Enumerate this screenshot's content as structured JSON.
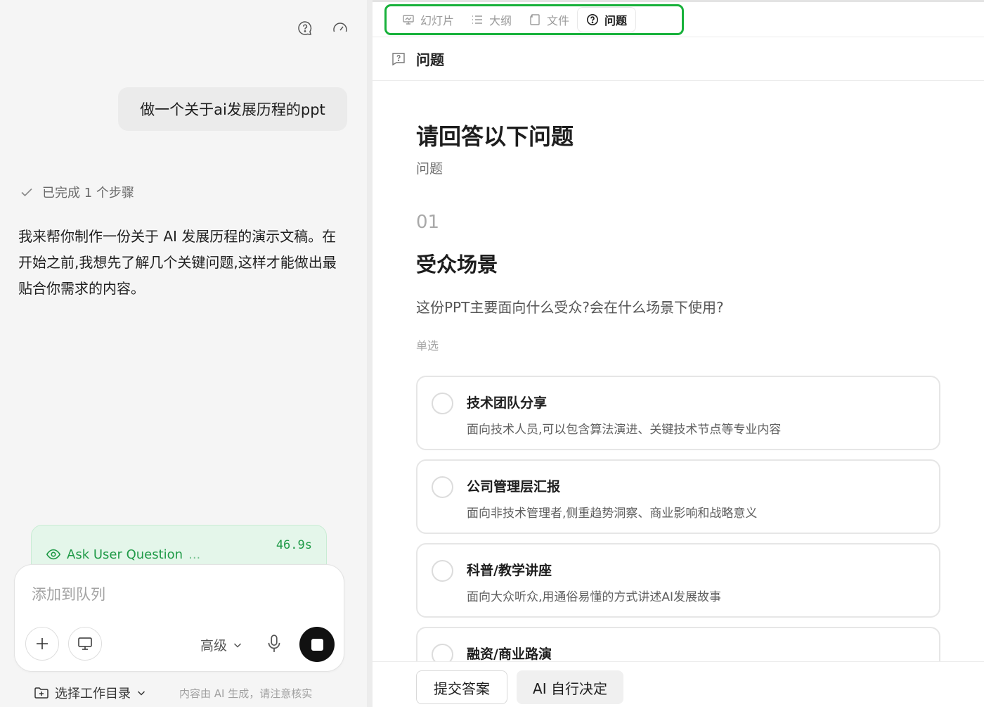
{
  "chat": {
    "user_message": "做一个关于ai发展历程的ppt",
    "steps_done": "已完成 1 个步骤",
    "assistant_message": "我来帮你制作一份关于 AI 发展历程的演示文稿。在开始之前,我想先了解几个关键问题,这样才能做出最贴合你需求的内容。",
    "tool": {
      "name": "Ask User Question",
      "dots": "...",
      "elapsed": "46.9s"
    },
    "composer": {
      "placeholder": "添加到队列",
      "advanced_label": "高级"
    },
    "footer": {
      "workdir_label": "选择工作目录",
      "note": "内容由 AI 生成，请注意核实"
    }
  },
  "tabs": [
    {
      "label": "幻灯片",
      "icon": "slides-icon",
      "active": false
    },
    {
      "label": "大纲",
      "icon": "list-icon",
      "active": false
    },
    {
      "label": "文件",
      "icon": "file-icon",
      "active": false
    },
    {
      "label": "问题",
      "icon": "question-circle-icon",
      "active": true
    }
  ],
  "panel": {
    "header": "问题",
    "title": "请回答以下问题",
    "subtitle": "问题",
    "question": {
      "number": "01",
      "heading": "受众场景",
      "text": "这份PPT主要面向什么受众?会在什么场景下使用?",
      "type": "单选",
      "options": [
        {
          "title": "技术团队分享",
          "desc": "面向技术人员,可以包含算法演进、关键技术节点等专业内容"
        },
        {
          "title": "公司管理层汇报",
          "desc": "面向非技术管理者,侧重趋势洞察、商业影响和战略意义"
        },
        {
          "title": "科普/教学讲座",
          "desc": "面向大众听众,用通俗易懂的方式讲述AI发展故事"
        },
        {
          "title": "融资/商业路演",
          "desc": ""
        }
      ]
    },
    "buttons": {
      "submit": "提交答案",
      "auto": "AI 自行决定"
    }
  },
  "colors": {
    "tab_highlight": "#17b13a",
    "tool_green": "#1f9a47",
    "tool_bg": "#e4f6ea"
  }
}
